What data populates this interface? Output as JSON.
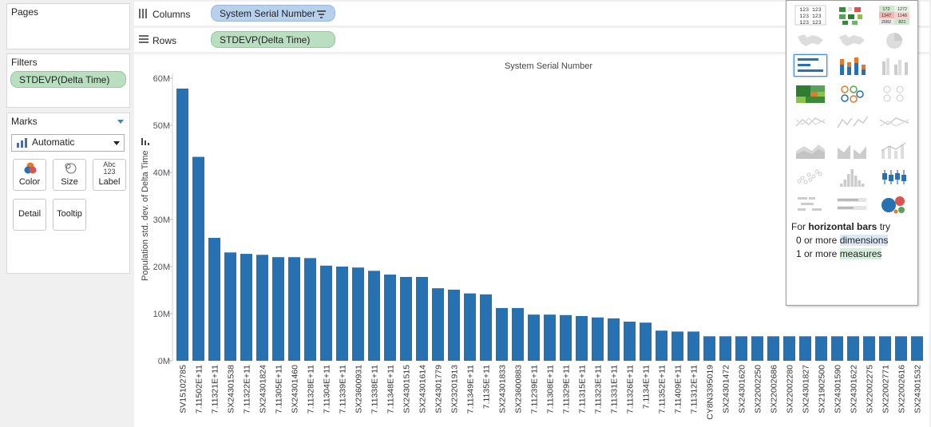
{
  "pages": {
    "title": "Pages"
  },
  "filters": {
    "title": "Filters",
    "pill": "STDEVP(Delta Time)"
  },
  "marks": {
    "title": "Marks",
    "type": "Automatic",
    "buttons": {
      "color": "Color",
      "size": "Size",
      "label": "Label",
      "label_glyph_top": "Abc",
      "label_glyph_bottom": "123",
      "detail": "Detail",
      "tooltip": "Tooltip"
    }
  },
  "shelves": {
    "columns": {
      "label": "Columns",
      "pill": "System Serial Number"
    },
    "rows": {
      "label": "Rows",
      "pill": "STDEVP(Delta Time)"
    }
  },
  "show_me": {
    "hint_prefix": "For ",
    "hint_bold": "horizontal bars",
    "hint_suffix": " try",
    "line1_count": "0 or more ",
    "line1_kind": "dimensions",
    "line2_count": "1 or more ",
    "line2_kind": "measures",
    "text_table_cells": [
      "123 123",
      "123 123",
      "123 123"
    ],
    "highlight_table_cells": [
      "172",
      "1272",
      "1347",
      "1148",
      "2082",
      "821"
    ]
  },
  "colors": {
    "bar": "#2671b2",
    "accent_blue": "#b7d0ec",
    "accent_green": "#b9dfc0"
  },
  "chart_data": {
    "type": "bar",
    "title": "System Serial Number",
    "ylabel": "Population std. dev. of Delta Time",
    "ylim": [
      0,
      60000000
    ],
    "yticks": [
      {
        "value": 0,
        "label": "0M"
      },
      {
        "value": 10000000,
        "label": "10M"
      },
      {
        "value": 20000000,
        "label": "20M"
      },
      {
        "value": 30000000,
        "label": "30M"
      },
      {
        "value": 40000000,
        "label": "40M"
      },
      {
        "value": 50000000,
        "label": "50M"
      },
      {
        "value": 60000000,
        "label": "60M"
      }
    ],
    "categories": [
      "SV15102785",
      "7.11502E+11",
      "7.11321E+11",
      "SX24301538",
      "7.11322E+11",
      "SX24301824",
      "7.11305E+11",
      "SX24301460",
      "7.11328E+11",
      "7.11304E+11",
      "7.11339E+11",
      "SX23600931",
      "7.11338E+11",
      "7.11348E+11",
      "SX24301515",
      "SX24301614",
      "SX24301779",
      "SX23201913",
      "7.11349E+11",
      "7.1135E+11",
      "SX24301833",
      "SX23600883",
      "7.11239E+11",
      "7.11308E+11",
      "7.11329E+11",
      "7.11315E+11",
      "7.11323E+11",
      "7.11331E+11",
      "7.11326E+11",
      "7.1134E+11",
      "7.11352E+11",
      "7.11409E+11",
      "7.11312E+11",
      "CY8N3395019",
      "SX24301472",
      "SX24301620",
      "SX22002250",
      "SX22002686",
      "SX22002280",
      "SX24301827",
      "SX21902500",
      "SX24301590",
      "SX24301622",
      "SX22002275",
      "SX22002771",
      "SX22002616",
      "SX24301532"
    ],
    "values": [
      57800000,
      43300000,
      26100000,
      23000000,
      22700000,
      22500000,
      22000000,
      22000000,
      21800000,
      20200000,
      20000000,
      19800000,
      19100000,
      18300000,
      17800000,
      17800000,
      15400000,
      15100000,
      14300000,
      14100000,
      11200000,
      11200000,
      9800000,
      9800000,
      9700000,
      9500000,
      9200000,
      9000000,
      8300000,
      8100000,
      6400000,
      6200000,
      6200000,
      5200000,
      5200000,
      5200000,
      5200000,
      5200000,
      5200000,
      5200000,
      5200000,
      5200000,
      5200000,
      5200000,
      5200000,
      5200000,
      5200000
    ]
  }
}
